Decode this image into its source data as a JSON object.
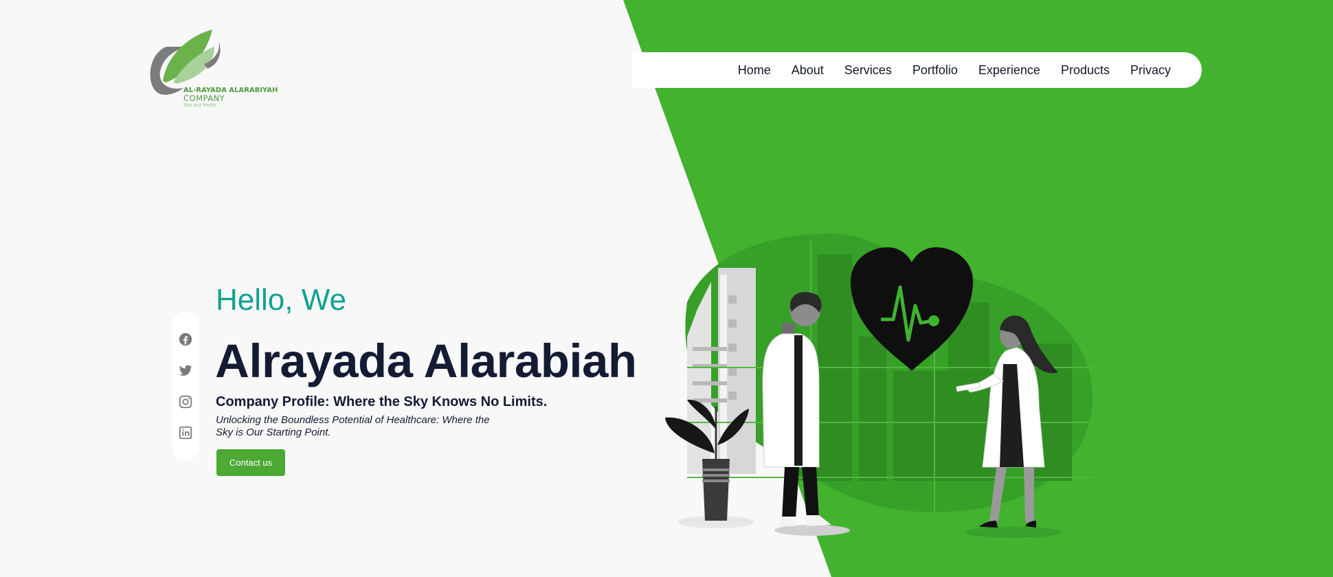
{
  "brand": {
    "name_line1": "AL-RAYADA ALARABIYAH",
    "name_line2": "COMPANY",
    "slogan": "Sky our limits"
  },
  "nav": {
    "items": [
      "Home",
      "About",
      "Services",
      "Portfolio",
      "Experience",
      "Products",
      "Privacy"
    ]
  },
  "social": {
    "icons": [
      "facebook-icon",
      "twitter-icon",
      "instagram-icon",
      "linkedin-icon"
    ]
  },
  "hero": {
    "greeting": "Hello, We",
    "title": "Alrayada Alarabiah",
    "subtitle": "Company Profile: Where the Sky Knows No Limits.",
    "tagline": "Unlocking the Boundless Potential of Healthcare: Where the Sky is Our Starting Point.",
    "cta_label": "Contact us"
  },
  "colors": {
    "accent_green": "#42b22f",
    "button_green": "#4ca934",
    "greeting_teal": "#10a28f",
    "heading_navy": "#141b34",
    "page_bg": "#f8f8f8"
  }
}
